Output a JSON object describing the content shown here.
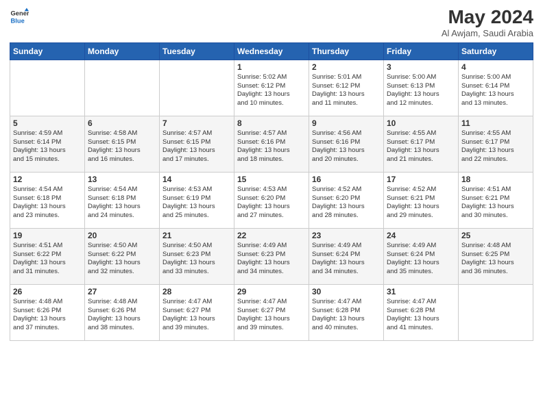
{
  "header": {
    "logo_line1": "General",
    "logo_line2": "Blue",
    "title": "May 2024",
    "subtitle": "Al Awjam, Saudi Arabia"
  },
  "columns": [
    "Sunday",
    "Monday",
    "Tuesday",
    "Wednesday",
    "Thursday",
    "Friday",
    "Saturday"
  ],
  "weeks": [
    [
      {
        "day": "",
        "info": ""
      },
      {
        "day": "",
        "info": ""
      },
      {
        "day": "",
        "info": ""
      },
      {
        "day": "1",
        "info": "Sunrise: 5:02 AM\nSunset: 6:12 PM\nDaylight: 13 hours\nand 10 minutes."
      },
      {
        "day": "2",
        "info": "Sunrise: 5:01 AM\nSunset: 6:12 PM\nDaylight: 13 hours\nand 11 minutes."
      },
      {
        "day": "3",
        "info": "Sunrise: 5:00 AM\nSunset: 6:13 PM\nDaylight: 13 hours\nand 12 minutes."
      },
      {
        "day": "4",
        "info": "Sunrise: 5:00 AM\nSunset: 6:14 PM\nDaylight: 13 hours\nand 13 minutes."
      }
    ],
    [
      {
        "day": "5",
        "info": "Sunrise: 4:59 AM\nSunset: 6:14 PM\nDaylight: 13 hours\nand 15 minutes."
      },
      {
        "day": "6",
        "info": "Sunrise: 4:58 AM\nSunset: 6:15 PM\nDaylight: 13 hours\nand 16 minutes."
      },
      {
        "day": "7",
        "info": "Sunrise: 4:57 AM\nSunset: 6:15 PM\nDaylight: 13 hours\nand 17 minutes."
      },
      {
        "day": "8",
        "info": "Sunrise: 4:57 AM\nSunset: 6:16 PM\nDaylight: 13 hours\nand 18 minutes."
      },
      {
        "day": "9",
        "info": "Sunrise: 4:56 AM\nSunset: 6:16 PM\nDaylight: 13 hours\nand 20 minutes."
      },
      {
        "day": "10",
        "info": "Sunrise: 4:55 AM\nSunset: 6:17 PM\nDaylight: 13 hours\nand 21 minutes."
      },
      {
        "day": "11",
        "info": "Sunrise: 4:55 AM\nSunset: 6:17 PM\nDaylight: 13 hours\nand 22 minutes."
      }
    ],
    [
      {
        "day": "12",
        "info": "Sunrise: 4:54 AM\nSunset: 6:18 PM\nDaylight: 13 hours\nand 23 minutes."
      },
      {
        "day": "13",
        "info": "Sunrise: 4:54 AM\nSunset: 6:18 PM\nDaylight: 13 hours\nand 24 minutes."
      },
      {
        "day": "14",
        "info": "Sunrise: 4:53 AM\nSunset: 6:19 PM\nDaylight: 13 hours\nand 25 minutes."
      },
      {
        "day": "15",
        "info": "Sunrise: 4:53 AM\nSunset: 6:20 PM\nDaylight: 13 hours\nand 27 minutes."
      },
      {
        "day": "16",
        "info": "Sunrise: 4:52 AM\nSunset: 6:20 PM\nDaylight: 13 hours\nand 28 minutes."
      },
      {
        "day": "17",
        "info": "Sunrise: 4:52 AM\nSunset: 6:21 PM\nDaylight: 13 hours\nand 29 minutes."
      },
      {
        "day": "18",
        "info": "Sunrise: 4:51 AM\nSunset: 6:21 PM\nDaylight: 13 hours\nand 30 minutes."
      }
    ],
    [
      {
        "day": "19",
        "info": "Sunrise: 4:51 AM\nSunset: 6:22 PM\nDaylight: 13 hours\nand 31 minutes."
      },
      {
        "day": "20",
        "info": "Sunrise: 4:50 AM\nSunset: 6:22 PM\nDaylight: 13 hours\nand 32 minutes."
      },
      {
        "day": "21",
        "info": "Sunrise: 4:50 AM\nSunset: 6:23 PM\nDaylight: 13 hours\nand 33 minutes."
      },
      {
        "day": "22",
        "info": "Sunrise: 4:49 AM\nSunset: 6:23 PM\nDaylight: 13 hours\nand 34 minutes."
      },
      {
        "day": "23",
        "info": "Sunrise: 4:49 AM\nSunset: 6:24 PM\nDaylight: 13 hours\nand 34 minutes."
      },
      {
        "day": "24",
        "info": "Sunrise: 4:49 AM\nSunset: 6:24 PM\nDaylight: 13 hours\nand 35 minutes."
      },
      {
        "day": "25",
        "info": "Sunrise: 4:48 AM\nSunset: 6:25 PM\nDaylight: 13 hours\nand 36 minutes."
      }
    ],
    [
      {
        "day": "26",
        "info": "Sunrise: 4:48 AM\nSunset: 6:26 PM\nDaylight: 13 hours\nand 37 minutes."
      },
      {
        "day": "27",
        "info": "Sunrise: 4:48 AM\nSunset: 6:26 PM\nDaylight: 13 hours\nand 38 minutes."
      },
      {
        "day": "28",
        "info": "Sunrise: 4:47 AM\nSunset: 6:27 PM\nDaylight: 13 hours\nand 39 minutes."
      },
      {
        "day": "29",
        "info": "Sunrise: 4:47 AM\nSunset: 6:27 PM\nDaylight: 13 hours\nand 39 minutes."
      },
      {
        "day": "30",
        "info": "Sunrise: 4:47 AM\nSunset: 6:28 PM\nDaylight: 13 hours\nand 40 minutes."
      },
      {
        "day": "31",
        "info": "Sunrise: 4:47 AM\nSunset: 6:28 PM\nDaylight: 13 hours\nand 41 minutes."
      },
      {
        "day": "",
        "info": ""
      }
    ]
  ]
}
